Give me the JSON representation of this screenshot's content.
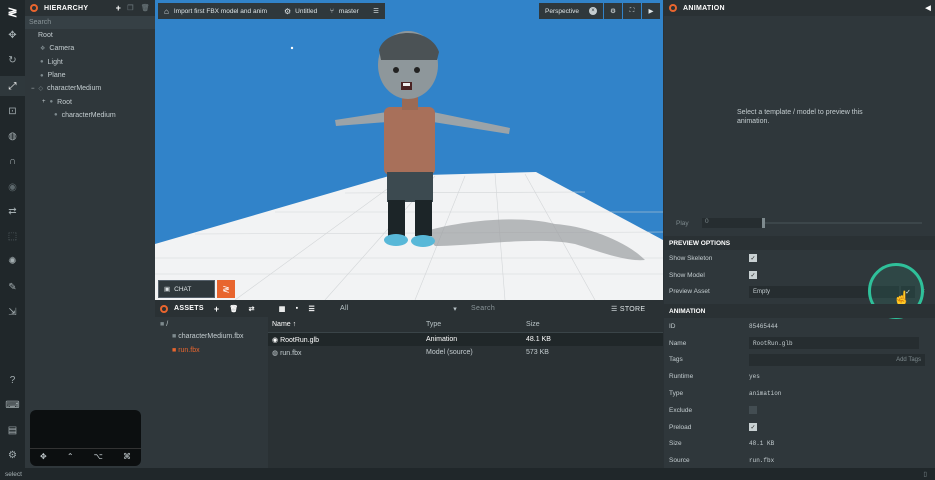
{
  "toolbar": {
    "active": "scale-icon"
  },
  "hierarchy": {
    "title": "HIERARCHY",
    "search_placeholder": "Search",
    "items": [
      {
        "label": "Root"
      },
      {
        "label": "Camera"
      },
      {
        "label": "Light"
      },
      {
        "label": "Plane"
      },
      {
        "label": "characterMedium"
      },
      {
        "label": "Root"
      },
      {
        "label": "characterMedium"
      }
    ]
  },
  "viewport": {
    "import_label": "Import first FBX model and anim",
    "scene_label": "Untitled",
    "branch_label": "master",
    "camera_label": "Perspective",
    "chat_label": "CHAT"
  },
  "assets": {
    "title": "ASSETS",
    "filter_value": "All",
    "search_placeholder": "Search",
    "store_label": "STORE",
    "path_root": "/",
    "folders": [
      {
        "label": "characterMedium.fbx"
      },
      {
        "label": "run.fbx"
      }
    ],
    "columns": {
      "name": "Name",
      "type": "Type",
      "size": "Size"
    },
    "rows": [
      {
        "name": "RootRun.glb",
        "type": "Animation",
        "size": "48.1 KB"
      },
      {
        "name": "run.fbx",
        "type": "Model (source)",
        "size": "573 KB"
      }
    ]
  },
  "animation": {
    "title": "ANIMATION",
    "preview_text": "Select a template / model to preview this animation.",
    "play_label": "Play",
    "play_value": "0",
    "preview_options": {
      "title": "PREVIEW OPTIONS",
      "show_skeleton": "Show Skeleton",
      "show_model": "Show Model",
      "preview_asset": "Preview Asset",
      "preview_asset_value": "Empty"
    },
    "section_title": "ANIMATION",
    "id_label": "ID",
    "id_value": "85465444",
    "name_label": "Name",
    "name_value": "RootRun.glb",
    "tags_label": "Tags",
    "add_tags": "Add Tags",
    "runtime_label": "Runtime",
    "runtime_value": "yes",
    "type_label": "Type",
    "type_value": "animation",
    "exclude_label": "Exclude",
    "preload_label": "Preload",
    "size_label": "Size",
    "size_value": "48.1 KB",
    "source_label": "Source",
    "source_value": "run.fbx"
  },
  "status": {
    "text": "select"
  },
  "colors": {
    "accent": "#e8652e",
    "sky": "#3182c8",
    "teal": "#2fc09a"
  }
}
